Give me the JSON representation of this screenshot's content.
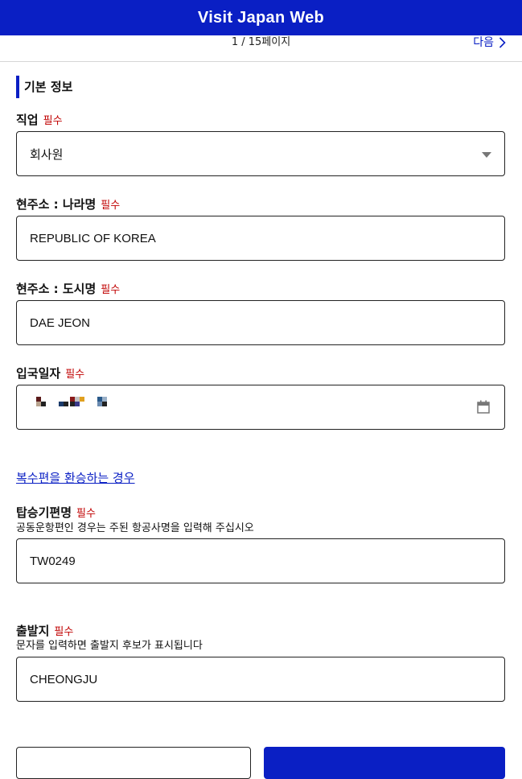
{
  "header": {
    "title": "Visit Japan Web"
  },
  "pager": {
    "indicator": "1 / 15페이지",
    "next_label": "다음"
  },
  "section": {
    "title": "기본 정보"
  },
  "required_label": "필수",
  "fields": {
    "occupation": {
      "label": "직업",
      "value": "회사원"
    },
    "country": {
      "label": "현주소 : 나라명",
      "value": "REPUBLIC OF KOREA"
    },
    "city": {
      "label": "현주소 : 도시명",
      "value": "DAE JEON"
    },
    "entry_date": {
      "label": "입국일자",
      "value": ""
    },
    "flight": {
      "label": "탑승기편명",
      "hint": "공동운항편인 경우는 주된 항공사명을 입력해 주십시오",
      "value": "TW0249"
    },
    "departure": {
      "label": "출발지",
      "hint": "문자를 입력하면 출발지 후보가 표시됩니다",
      "value": "CHEONGJU"
    }
  },
  "connecting_link": "복수편을 환승하는 경우",
  "colors": {
    "brand": "#0a1fc4",
    "required": "#c00000"
  },
  "icons": {
    "next": "chevron-right-icon",
    "select": "caret-down-icon",
    "date": "calendar-icon"
  }
}
